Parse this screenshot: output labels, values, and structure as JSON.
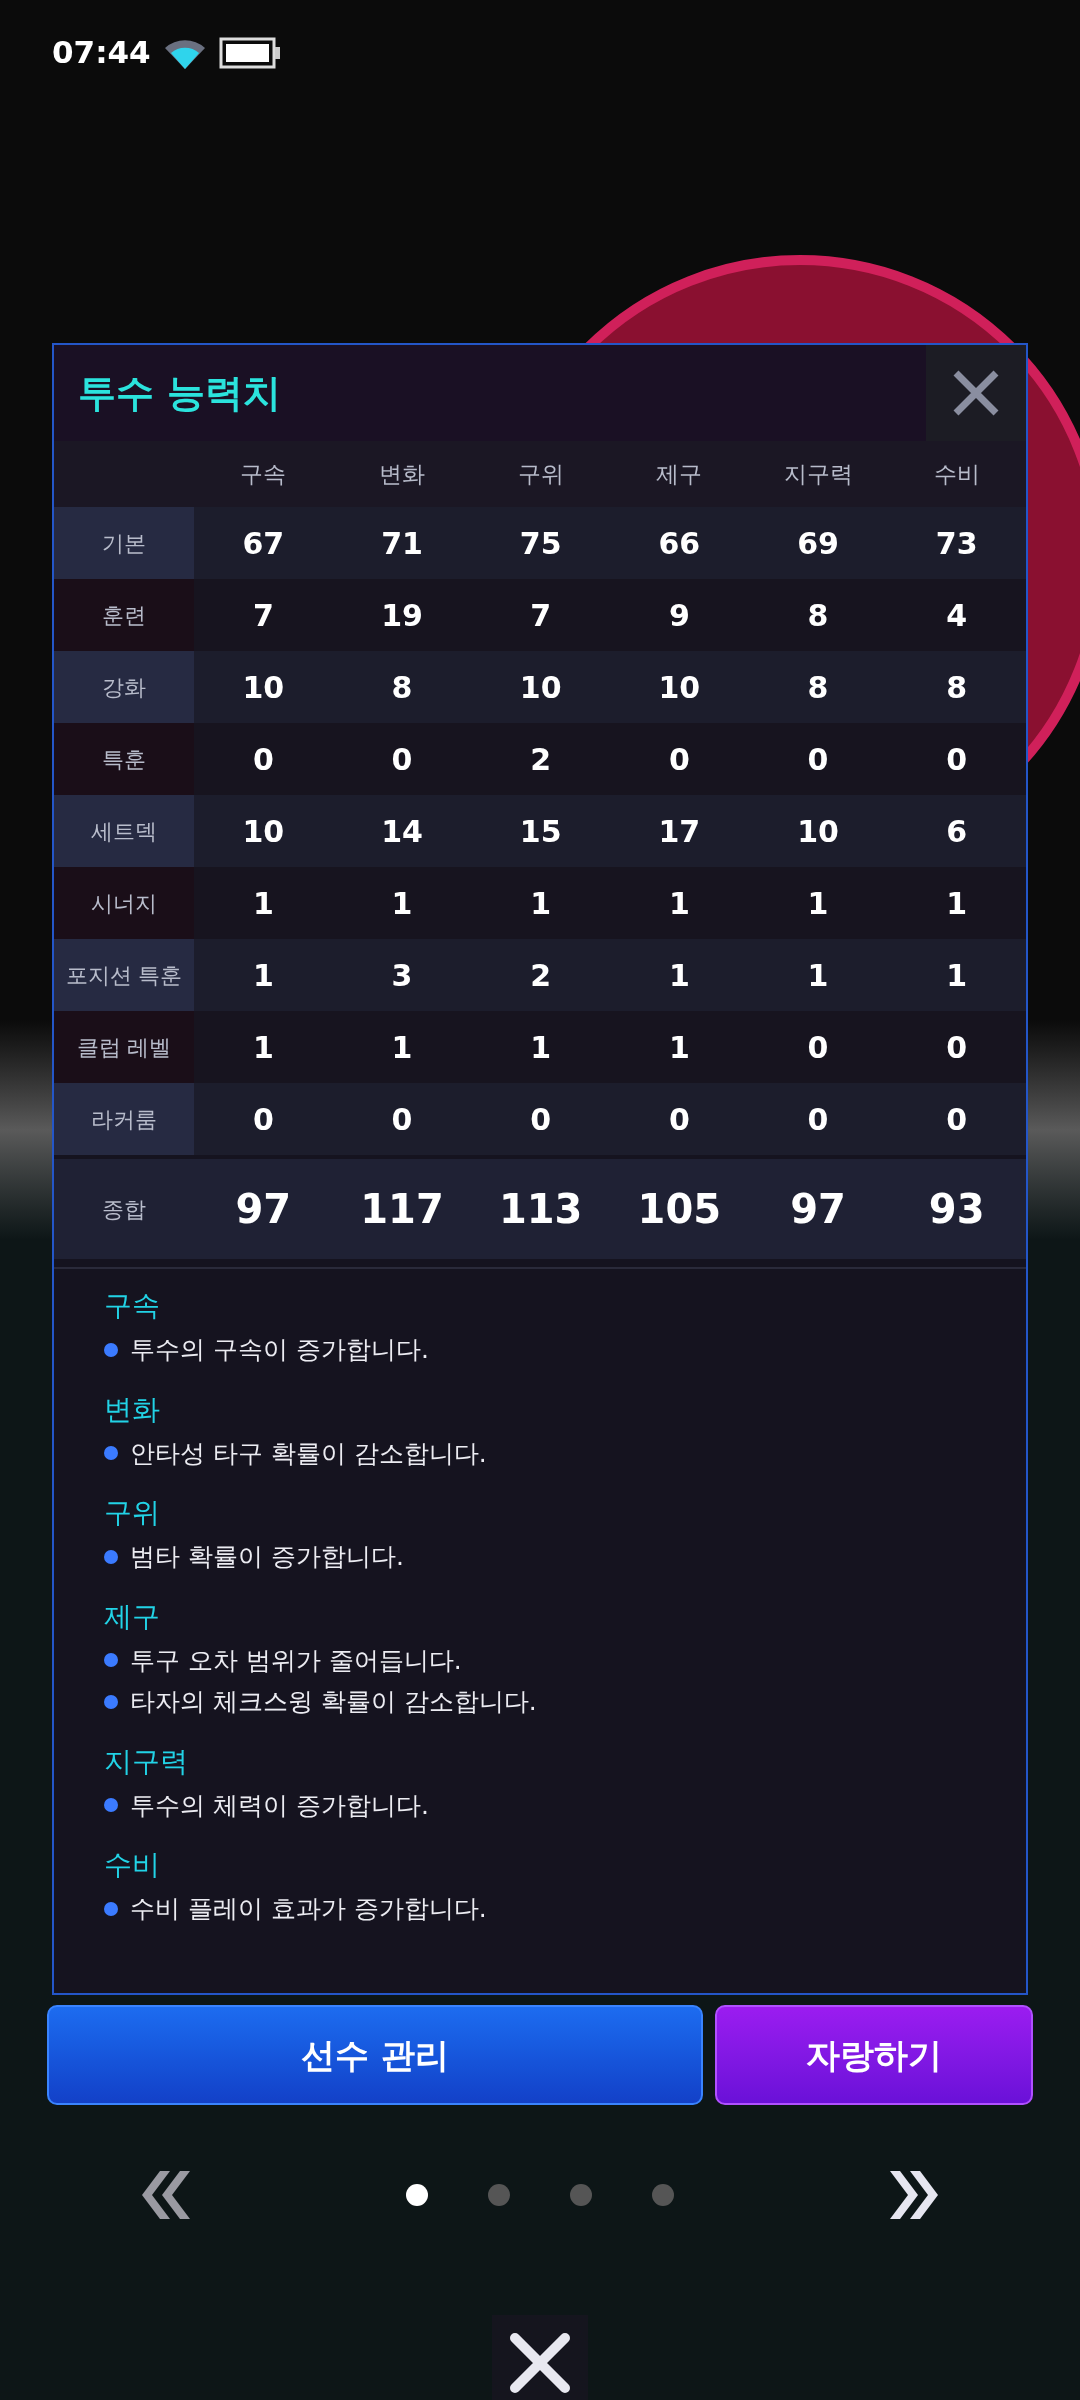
{
  "status_bar": {
    "time": "07:44"
  },
  "dialog": {
    "title": "투수 능력치",
    "columns": [
      "구속",
      "변화",
      "구위",
      "제구",
      "지구력",
      "수비"
    ],
    "rows": [
      {
        "label": "기본",
        "values": [
          "67",
          "71",
          "75",
          "66",
          "69",
          "73"
        ]
      },
      {
        "label": "훈련",
        "values": [
          "7",
          "19",
          "7",
          "9",
          "8",
          "4"
        ]
      },
      {
        "label": "강화",
        "values": [
          "10",
          "8",
          "10",
          "10",
          "8",
          "8"
        ]
      },
      {
        "label": "특훈",
        "values": [
          "0",
          "0",
          "2",
          "0",
          "0",
          "0"
        ]
      },
      {
        "label": "세트덱",
        "values": [
          "10",
          "14",
          "15",
          "17",
          "10",
          "6"
        ]
      },
      {
        "label": "시너지",
        "values": [
          "1",
          "1",
          "1",
          "1",
          "1",
          "1"
        ]
      },
      {
        "label": "포지션 특훈",
        "values": [
          "1",
          "3",
          "2",
          "1",
          "1",
          "1"
        ]
      },
      {
        "label": "클럽 레벨",
        "values": [
          "1",
          "1",
          "1",
          "1",
          "0",
          "0"
        ]
      },
      {
        "label": "라커룸",
        "values": [
          "0",
          "0",
          "0",
          "0",
          "0",
          "0"
        ]
      }
    ],
    "total": {
      "label": "종합",
      "values": [
        "97",
        "117",
        "113",
        "105",
        "97",
        "93"
      ]
    },
    "descriptions": [
      {
        "title": "구속",
        "bullets": [
          "투수의 구속이 증가합니다."
        ]
      },
      {
        "title": "변화",
        "bullets": [
          "안타성 타구 확률이 감소합니다."
        ]
      },
      {
        "title": "구위",
        "bullets": [
          "범타 확률이 증가합니다."
        ]
      },
      {
        "title": "제구",
        "bullets": [
          "투구 오차 범위가 줄어듭니다.",
          "타자의 체크스윙 확률이 감소합니다."
        ]
      },
      {
        "title": "지구력",
        "bullets": [
          "투수의 체력이 증가합니다."
        ]
      },
      {
        "title": "수비",
        "bullets": [
          "수비 플레이 효과가 증가합니다."
        ]
      }
    ]
  },
  "buttons": [
    {
      "label": "선수 관리",
      "kind": "primary"
    },
    {
      "label": "자랑하기",
      "kind": "secondary"
    }
  ],
  "pages": [
    {
      "selected": true
    },
    {
      "selected": false
    },
    {
      "selected": false
    },
    {
      "selected": false
    }
  ]
}
